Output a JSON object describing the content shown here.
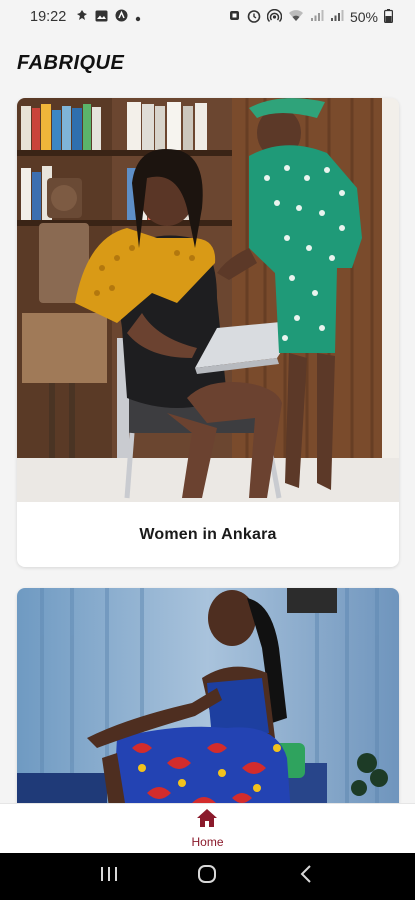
{
  "status_bar": {
    "time": "19:22",
    "battery": "50%",
    "left_icons": [
      "notification-icon",
      "gallery-icon",
      "app-icon",
      "dot-icon"
    ],
    "right_icons": [
      "alarm-icon",
      "clock-icon",
      "hotspot-icon",
      "wifi-icon",
      "signal-icon",
      "signal-icon",
      "battery-icon"
    ]
  },
  "app": {
    "title": "FABRIQUE"
  },
  "cards": [
    {
      "caption": "Women in Ankara",
      "image": "women-in-ankara-photo"
    },
    {
      "caption": "",
      "image": "ankara-dress-photo"
    }
  ],
  "bottom_nav": {
    "home_label": "Home",
    "active_color": "#8b1a2b"
  },
  "system_nav": {
    "buttons": [
      "recent-apps",
      "home",
      "back"
    ]
  }
}
